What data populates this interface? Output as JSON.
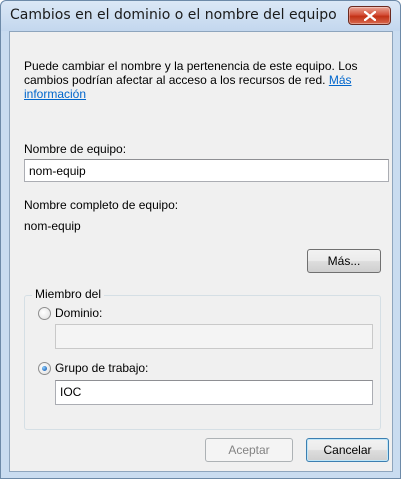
{
  "window": {
    "title": "Cambios en el dominio o el nombre del equipo"
  },
  "description": {
    "text": "Puede cambiar el nombre y la pertenencia de este equipo. Los cambios podrían afectar al acceso a los recursos de red. ",
    "link": "Más información"
  },
  "computer_name": {
    "label": "Nombre de equipo:",
    "value": "nom-equip"
  },
  "full_computer_name": {
    "label": "Nombre completo de equipo:",
    "value": "nom-equip"
  },
  "more_button": "Más...",
  "member_of": {
    "legend": "Miembro del",
    "domain": {
      "label": "Dominio:",
      "selected": false,
      "value": ""
    },
    "workgroup": {
      "label": "Grupo de trabajo:",
      "selected": true,
      "value": "IOC"
    }
  },
  "buttons": {
    "ok": "Aceptar",
    "cancel": "Cancelar"
  }
}
